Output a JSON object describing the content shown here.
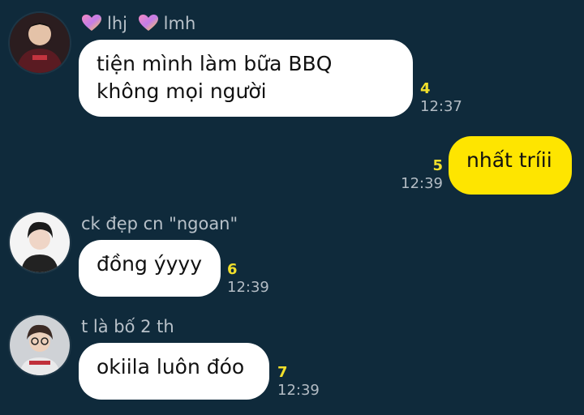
{
  "messages": [
    {
      "sender": {
        "tag1": "lhj",
        "tag2": "lmh"
      },
      "text_line1": "tiện mình làm bữa BBQ",
      "text_line2": "không mọi người",
      "unread": "4",
      "time": "12:37"
    },
    {
      "text": "nhất tríii",
      "unread": "5",
      "time": "12:39"
    },
    {
      "sender": "ck đẹp cn \"ngoan\"",
      "text": "đồng ýyyy",
      "unread": "6",
      "time": "12:39"
    },
    {
      "sender": "t là bố 2 th",
      "text": "okiila luôn đóo",
      "unread": "7",
      "time": "12:39"
    }
  ],
  "colors": {
    "background": "#0f2a3b",
    "incoming_bubble": "#ffffff",
    "outgoing_bubble": "#fee500",
    "unread_count": "#f1df2b",
    "timestamp": "#b3bcc4"
  },
  "icons": [
    "avatar",
    "heart-icon"
  ]
}
